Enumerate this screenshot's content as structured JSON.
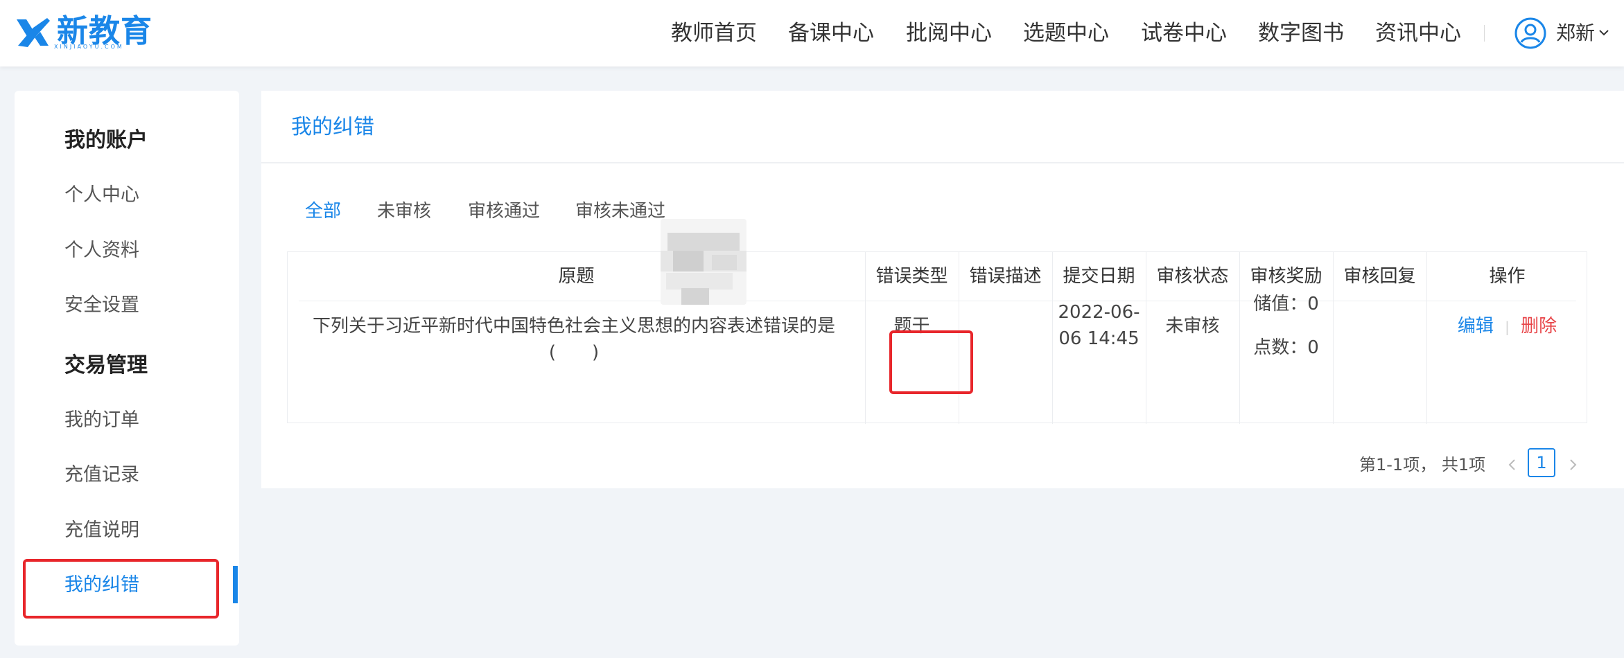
{
  "header": {
    "logo_text": "新教育",
    "logo_sub": "XINJIAOYU.COM",
    "nav": [
      "教师首页",
      "备课中心",
      "批阅中心",
      "选题中心",
      "试卷中心",
      "数字图书",
      "资讯中心"
    ],
    "user_name": "郑新"
  },
  "sidebar": {
    "groups": [
      {
        "title": "我的账户",
        "items": [
          "个人中心",
          "个人资料",
          "安全设置"
        ]
      },
      {
        "title": "交易管理",
        "items": [
          "我的订单",
          "充值记录",
          "充值说明",
          "我的纠错"
        ]
      }
    ],
    "active_item": "我的纠错"
  },
  "main": {
    "title": "我的纠错",
    "tabs": [
      "全部",
      "未审核",
      "审核通过",
      "审核未通过"
    ],
    "active_tab": "全部",
    "table": {
      "headers": [
        "原题",
        "错误类型",
        "错误描述",
        "提交日期",
        "审核状态",
        "审核奖励",
        "审核回复",
        "操作"
      ],
      "rows": [
        {
          "question": "下列关于习近平新时代中国特色社会主义思想的内容表述错误的是(　　)",
          "error_type": "题干",
          "description": "",
          "date_line1": "2022-06-",
          "date_line2": "06 14:45",
          "status": "未审核",
          "reward_value": "储值：0",
          "reward_points": "点数：0",
          "reply": "",
          "op_edit": "编辑",
          "op_sep": "|",
          "op_delete": "删除"
        }
      ]
    },
    "pagination": {
      "summary": "第1-1项，  共1项",
      "current_page": "1"
    }
  },
  "colors": {
    "primary": "#1a86e8",
    "danger": "#e8474b",
    "highlight_box": "#e8262b",
    "page_bg": "#f1f4f8"
  },
  "icons": [
    "logo-x-icon",
    "user-avatar-icon",
    "chevron-down-icon",
    "pager-prev-icon",
    "pager-next-icon"
  ]
}
